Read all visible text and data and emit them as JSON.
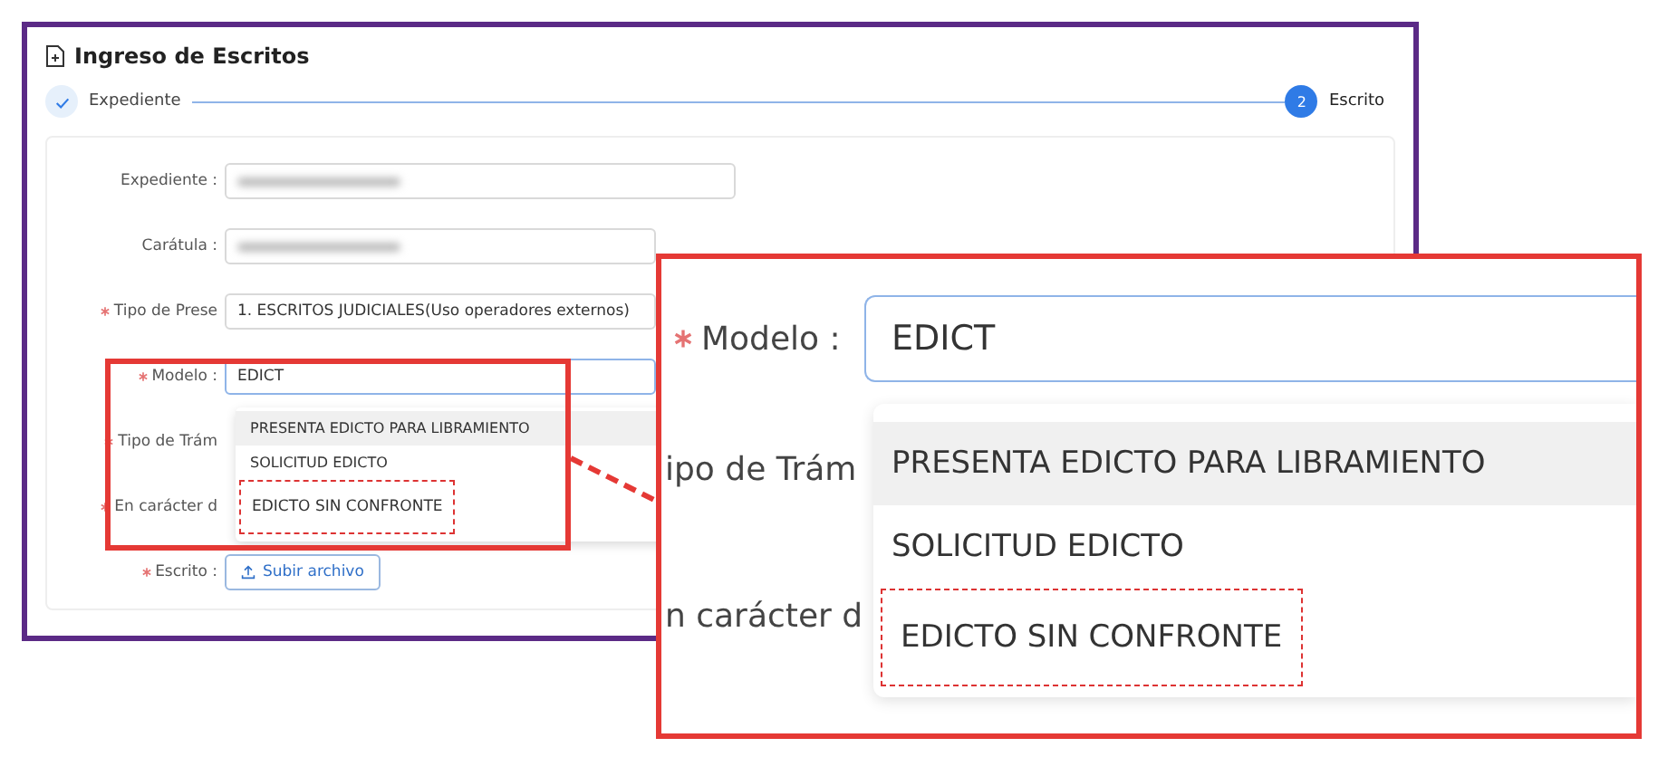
{
  "window": {
    "title": "Ingreso de Escritos"
  },
  "steps": [
    {
      "label": "Expediente",
      "kind": "done",
      "selected": false
    },
    {
      "label": "Escrito",
      "kind": "number",
      "number": "2",
      "selected": true
    }
  ],
  "form": {
    "fields": [
      {
        "label": "Expediente :",
        "required": false,
        "kind": "blurred"
      },
      {
        "label": "Carátula :",
        "required": false,
        "kind": "blurred"
      },
      {
        "label": "Tipo de Prese",
        "required": true,
        "kind": "text",
        "value": "1. ESCRITOS JUDICIALES(Uso operadores externos)"
      },
      {
        "label": "Modelo :",
        "required": true,
        "kind": "combo",
        "value": "EDICT"
      },
      {
        "label": "Tipo de Trám",
        "required": true,
        "kind": "covered"
      },
      {
        "label": "En carácter d",
        "required": true,
        "kind": "covered"
      },
      {
        "label": "Escrito :",
        "required": true,
        "kind": "upload",
        "button": "Subir archivo"
      }
    ]
  },
  "dropdown": {
    "options": [
      {
        "label": "PRESENTA EDICTO PARA LIBRAMIENTO",
        "hovered": true,
        "highlighted": false
      },
      {
        "label": "SOLICITUD EDICTO",
        "hovered": false,
        "highlighted": false
      },
      {
        "label": "EDICTO SIN CONFRONTE",
        "hovered": false,
        "highlighted": true
      }
    ]
  },
  "callout": {
    "field_label": "Modelo :",
    "value": "EDICT",
    "side_labels": [
      "ipo de Trám",
      "n carácter d"
    ],
    "options": [
      {
        "label": "PRESENTA EDICTO PARA LIBRAMIENTO",
        "hovered": true,
        "highlighted": false
      },
      {
        "label": "SOLICITUD EDICTO",
        "hovered": false,
        "highlighted": false
      },
      {
        "label": "EDICTO SIN CONFRONTE",
        "hovered": false,
        "highlighted": true
      }
    ]
  }
}
